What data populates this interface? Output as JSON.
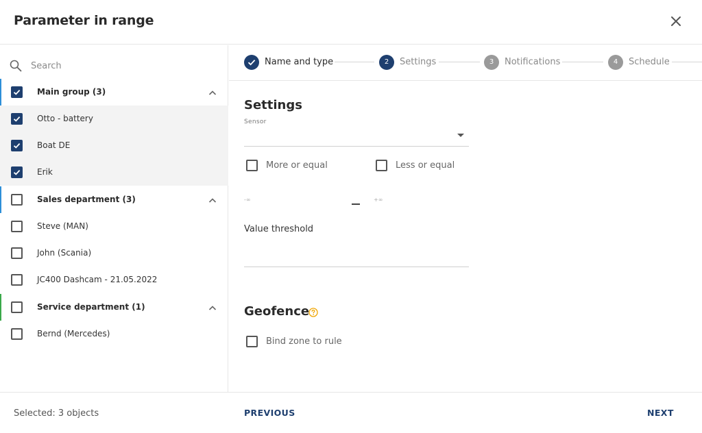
{
  "dialog": {
    "title": "Parameter in range"
  },
  "colors": {
    "accent": "#1e3f6f",
    "group_main": "#2e8fd8",
    "group_sales": "#2e8fd8",
    "group_service": "#3aa84a",
    "help": "#f0a500"
  },
  "search": {
    "placeholder": "Search",
    "value": ""
  },
  "tree": [
    {
      "label": "Main group (3)",
      "type": "group",
      "checked": true,
      "expanded": true
    },
    {
      "label": "Otto - battery",
      "type": "item",
      "checked": true
    },
    {
      "label": "Boat DE",
      "type": "item",
      "checked": true
    },
    {
      "label": "Erik",
      "type": "item",
      "checked": true
    },
    {
      "label": "Sales department (3)",
      "type": "group",
      "checked": false,
      "expanded": true
    },
    {
      "label": "Steve (MAN)",
      "type": "item",
      "checked": false
    },
    {
      "label": "John (Scania)",
      "type": "item",
      "checked": false
    },
    {
      "label": "JC400 Dashcam - 21.05.2022",
      "type": "item",
      "checked": false
    },
    {
      "label": "Service department (1)",
      "type": "group",
      "checked": false,
      "expanded": true
    },
    {
      "label": "Bernd (Mercedes)",
      "type": "item",
      "checked": false
    }
  ],
  "steps": [
    {
      "number": "1",
      "label": "Name and type",
      "state": "done"
    },
    {
      "number": "2",
      "label": "Settings",
      "state": "active"
    },
    {
      "number": "3",
      "label": "Notifications",
      "state": "todo"
    },
    {
      "number": "4",
      "label": "Schedule",
      "state": "todo"
    }
  ],
  "settings": {
    "title": "Settings",
    "sensor_label": "Sensor",
    "sensor_value": "",
    "more_or_equal": "More or equal",
    "less_or_equal": "Less or equal",
    "range_min_placeholder": "-∞",
    "range_max_placeholder": "+∞",
    "value_threshold_label": "Value threshold",
    "value_threshold_value": ""
  },
  "geofence": {
    "title": "Geofence",
    "bind_zone": "Bind zone to rule"
  },
  "footer": {
    "status": "Selected: 3 objects",
    "previous": "PREVIOUS",
    "next": "NEXT"
  }
}
